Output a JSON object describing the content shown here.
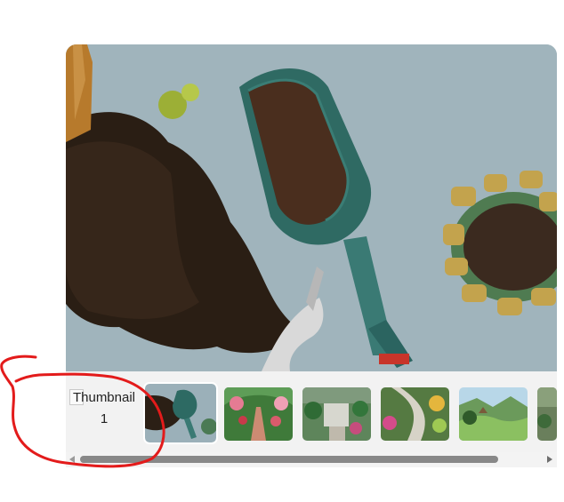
{
  "gallery": {
    "main_image": {
      "description_icon": "garden-tools-photo"
    },
    "thumbnails": [
      {
        "label": "Thumbnail 1",
        "state": "broken"
      },
      {
        "label": "",
        "state": "active",
        "icon": "soil-scoop-photo"
      },
      {
        "label": "",
        "state": "normal",
        "icon": "garden-arch-photo"
      },
      {
        "label": "",
        "state": "normal",
        "icon": "courtyard-garden-photo"
      },
      {
        "label": "",
        "state": "normal",
        "icon": "flower-path-photo"
      },
      {
        "label": "",
        "state": "normal",
        "icon": "green-valley-photo"
      },
      {
        "label": "",
        "state": "partial",
        "icon": "partial-garden-photo"
      }
    ],
    "scrollbar": {
      "position_fraction": 0.02
    }
  },
  "colors": {
    "annotation_stroke": "#e31b1b",
    "strip_background": "#f2f2f2",
    "scroll_thumb": "#888888"
  }
}
